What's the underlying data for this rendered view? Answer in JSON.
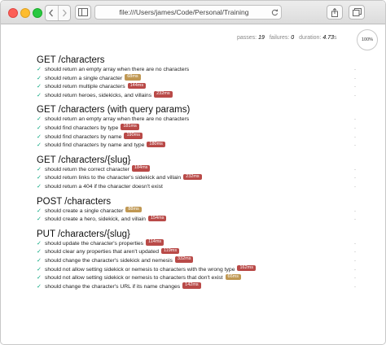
{
  "browser": {
    "address": "file:///Users/james/Code/Personal/Training",
    "colors": {
      "close": "#fc5f57",
      "minimize": "#fdbc2e",
      "zoom": "#28c840"
    }
  },
  "stats": {
    "passes_label": "passes:",
    "passes": "19",
    "failures_label": "failures:",
    "failures": "0",
    "duration_label": "duration:",
    "duration": "4.73",
    "duration_unit": "s",
    "progress": "100%"
  },
  "colors": {
    "pass_check": "#00a47a",
    "slow": "#b94a48",
    "medium": "#c09853"
  },
  "suites": [
    {
      "title": "GET /characters",
      "tests": [
        {
          "name": "should return an empty array when there are no characters"
        },
        {
          "name": "should return a single character",
          "duration": "68ms",
          "speed": "medium"
        },
        {
          "name": "should return multiple characters",
          "duration": "144ms",
          "speed": "slow"
        },
        {
          "name": "should return heroes, sidekicks, and villains",
          "duration": "232ms",
          "speed": "slow"
        }
      ]
    },
    {
      "title": "GET /characters (with query params)",
      "tests": [
        {
          "name": "should return an empty array when there are no characters"
        },
        {
          "name": "should find characters by type",
          "duration": "181ms",
          "speed": "slow"
        },
        {
          "name": "should find characters by name",
          "duration": "190ms",
          "speed": "slow"
        },
        {
          "name": "should find characters by name and type",
          "duration": "180ms",
          "speed": "slow"
        }
      ]
    },
    {
      "title": "GET /characters/{slug}",
      "tests": [
        {
          "name": "should return the correct character",
          "duration": "184ms",
          "speed": "slow"
        },
        {
          "name": "should return links to the character's sidekick and villain",
          "duration": "232ms",
          "speed": "slow"
        },
        {
          "name": "should return a 404 if the character doesn't exist"
        }
      ]
    },
    {
      "title": "POST /characters",
      "tests": [
        {
          "name": "should create a single character",
          "duration": "88ms",
          "speed": "medium"
        },
        {
          "name": "should create a hero, sidekick, and villain",
          "duration": "154ms",
          "speed": "slow"
        }
      ]
    },
    {
      "title": "PUT /characters/{slug}",
      "tests": [
        {
          "name": "should update the character's properties",
          "duration": "114ms",
          "speed": "slow"
        },
        {
          "name": "should clear any properties that aren't updated",
          "duration": "119ms",
          "speed": "slow"
        },
        {
          "name": "should change the character's sidekick and nemesis",
          "duration": "332ms",
          "speed": "slow"
        },
        {
          "name": "should not allow setting sidekick or nemesis to characters with the wrong type",
          "duration": "162ms",
          "speed": "slow"
        },
        {
          "name": "should not allow setting sidekick or nemesis to characters that don't exist",
          "duration": "66ms",
          "speed": "medium"
        },
        {
          "name": "should change the character's URL if its name changes",
          "duration": "142ms",
          "speed": "slow"
        }
      ]
    }
  ]
}
